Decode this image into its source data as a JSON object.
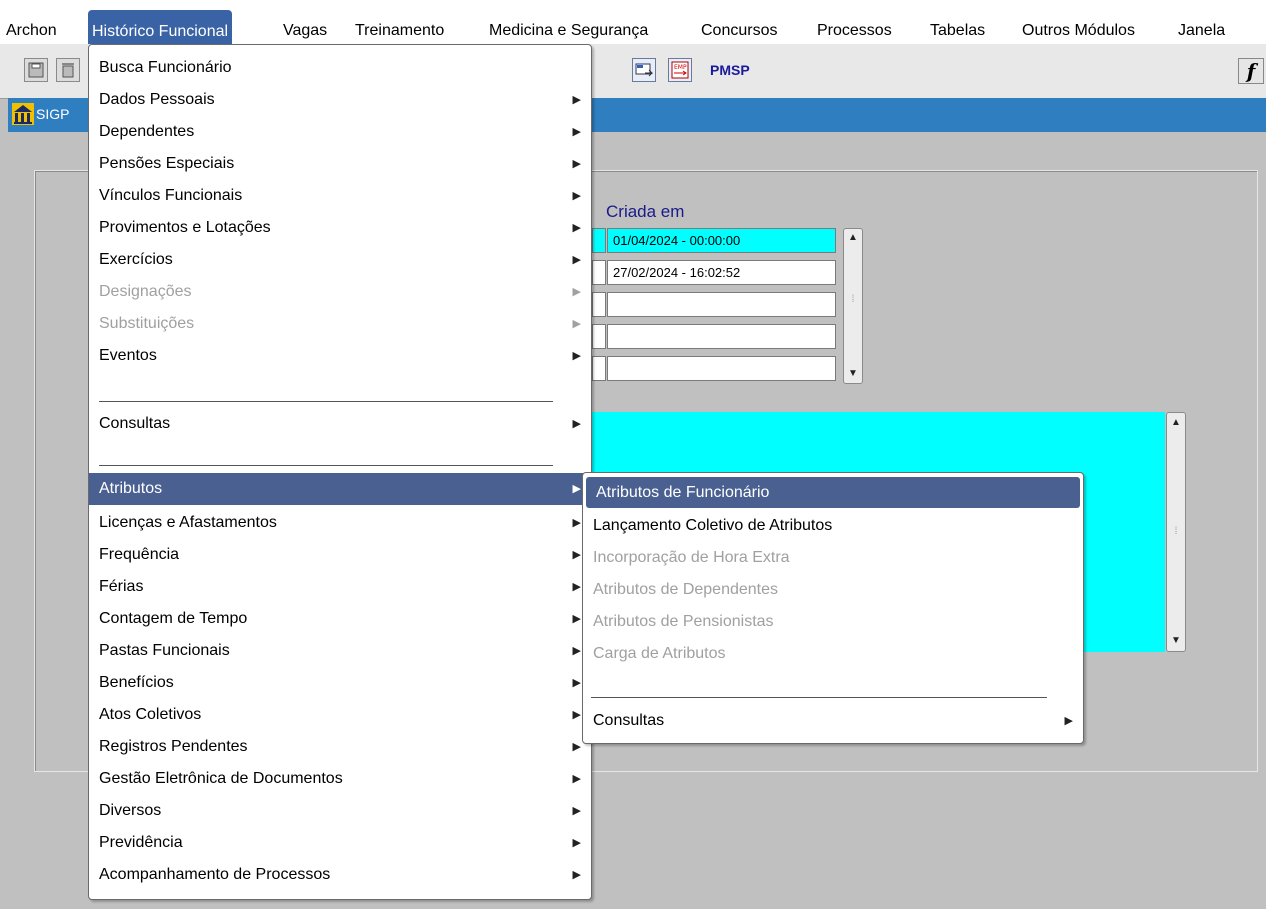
{
  "menubar": {
    "archon": "Archon",
    "historico": "Histórico Funcional",
    "vagas": "Vagas",
    "treinamento": "Treinamento",
    "medicina": "Medicina e Segurança",
    "concursos": "Concursos",
    "processos": "Processos",
    "tabelas": "Tabelas",
    "outros": "Outros Módulos",
    "janela": "Janela"
  },
  "toolbar": {
    "org_label": "PMSP",
    "f_label": "f"
  },
  "window": {
    "title": "SIGP"
  },
  "form": {
    "header_created": "Criada em",
    "rows": [
      {
        "created": "01/04/2024  -  00:00:00"
      },
      {
        "created": "27/02/2024  -  16:02:52"
      },
      {
        "created": ""
      },
      {
        "created": ""
      },
      {
        "created": ""
      }
    ]
  },
  "menu_main": {
    "busca": "Busca Funcionário",
    "dados": "Dados Pessoais",
    "dependentes": "Dependentes",
    "pensoes": "Pensões Especiais",
    "vinculos": "Vínculos Funcionais",
    "provimentos": "Provimentos e Lotações",
    "exercicios": "Exercícios",
    "designacoes": "Designações",
    "substituicoes": "Substituições",
    "eventos": "Eventos",
    "consultas": "Consultas",
    "atributos": "Atributos",
    "licencas": "Licenças e Afastamentos",
    "frequencia": "Frequência",
    "ferias": "Férias",
    "contagem": "Contagem de Tempo",
    "pastas": "Pastas Funcionais",
    "beneficios": "Benefícios",
    "atos": "Atos Coletivos",
    "registros": "Registros Pendentes",
    "gestao": "Gestão Eletrônica de Documentos",
    "diversos": "Diversos",
    "previdencia": "Previdência",
    "acompanhamento": "Acompanhamento de Processos"
  },
  "menu_atributos": {
    "funcionario": "Atributos de Funcionário",
    "lancamento": "Lançamento Coletivo de Atributos",
    "incorporacao": "Incorporação de Hora Extra",
    "dependentes": "Atributos de Dependentes",
    "pensionistas": "Atributos de Pensionistas",
    "carga": "Carga de Atributos",
    "consultas": "Consultas"
  },
  "colors": {
    "menu_highlight": "#4a6090",
    "title_bar": "#2f7ebf",
    "field_cyan": "#00ffff"
  }
}
